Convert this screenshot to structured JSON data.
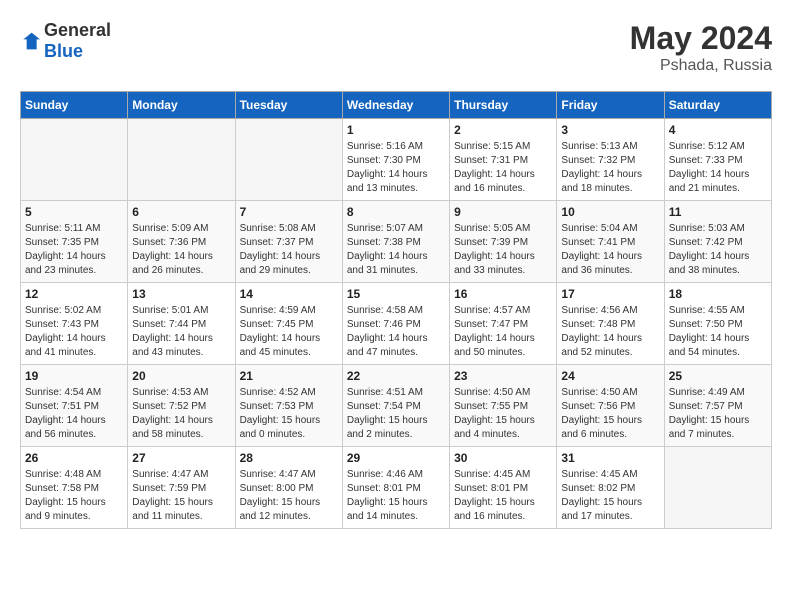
{
  "logo": {
    "general": "General",
    "blue": "Blue"
  },
  "title": {
    "month_year": "May 2024",
    "location": "Pshada, Russia"
  },
  "days_of_week": [
    "Sunday",
    "Monday",
    "Tuesday",
    "Wednesday",
    "Thursday",
    "Friday",
    "Saturday"
  ],
  "weeks": [
    [
      {
        "day": "",
        "info": ""
      },
      {
        "day": "",
        "info": ""
      },
      {
        "day": "",
        "info": ""
      },
      {
        "day": "1",
        "info": "Sunrise: 5:16 AM\nSunset: 7:30 PM\nDaylight: 14 hours\nand 13 minutes."
      },
      {
        "day": "2",
        "info": "Sunrise: 5:15 AM\nSunset: 7:31 PM\nDaylight: 14 hours\nand 16 minutes."
      },
      {
        "day": "3",
        "info": "Sunrise: 5:13 AM\nSunset: 7:32 PM\nDaylight: 14 hours\nand 18 minutes."
      },
      {
        "day": "4",
        "info": "Sunrise: 5:12 AM\nSunset: 7:33 PM\nDaylight: 14 hours\nand 21 minutes."
      }
    ],
    [
      {
        "day": "5",
        "info": "Sunrise: 5:11 AM\nSunset: 7:35 PM\nDaylight: 14 hours\nand 23 minutes."
      },
      {
        "day": "6",
        "info": "Sunrise: 5:09 AM\nSunset: 7:36 PM\nDaylight: 14 hours\nand 26 minutes."
      },
      {
        "day": "7",
        "info": "Sunrise: 5:08 AM\nSunset: 7:37 PM\nDaylight: 14 hours\nand 29 minutes."
      },
      {
        "day": "8",
        "info": "Sunrise: 5:07 AM\nSunset: 7:38 PM\nDaylight: 14 hours\nand 31 minutes."
      },
      {
        "day": "9",
        "info": "Sunrise: 5:05 AM\nSunset: 7:39 PM\nDaylight: 14 hours\nand 33 minutes."
      },
      {
        "day": "10",
        "info": "Sunrise: 5:04 AM\nSunset: 7:41 PM\nDaylight: 14 hours\nand 36 minutes."
      },
      {
        "day": "11",
        "info": "Sunrise: 5:03 AM\nSunset: 7:42 PM\nDaylight: 14 hours\nand 38 minutes."
      }
    ],
    [
      {
        "day": "12",
        "info": "Sunrise: 5:02 AM\nSunset: 7:43 PM\nDaylight: 14 hours\nand 41 minutes."
      },
      {
        "day": "13",
        "info": "Sunrise: 5:01 AM\nSunset: 7:44 PM\nDaylight: 14 hours\nand 43 minutes."
      },
      {
        "day": "14",
        "info": "Sunrise: 4:59 AM\nSunset: 7:45 PM\nDaylight: 14 hours\nand 45 minutes."
      },
      {
        "day": "15",
        "info": "Sunrise: 4:58 AM\nSunset: 7:46 PM\nDaylight: 14 hours\nand 47 minutes."
      },
      {
        "day": "16",
        "info": "Sunrise: 4:57 AM\nSunset: 7:47 PM\nDaylight: 14 hours\nand 50 minutes."
      },
      {
        "day": "17",
        "info": "Sunrise: 4:56 AM\nSunset: 7:48 PM\nDaylight: 14 hours\nand 52 minutes."
      },
      {
        "day": "18",
        "info": "Sunrise: 4:55 AM\nSunset: 7:50 PM\nDaylight: 14 hours\nand 54 minutes."
      }
    ],
    [
      {
        "day": "19",
        "info": "Sunrise: 4:54 AM\nSunset: 7:51 PM\nDaylight: 14 hours\nand 56 minutes."
      },
      {
        "day": "20",
        "info": "Sunrise: 4:53 AM\nSunset: 7:52 PM\nDaylight: 14 hours\nand 58 minutes."
      },
      {
        "day": "21",
        "info": "Sunrise: 4:52 AM\nSunset: 7:53 PM\nDaylight: 15 hours\nand 0 minutes."
      },
      {
        "day": "22",
        "info": "Sunrise: 4:51 AM\nSunset: 7:54 PM\nDaylight: 15 hours\nand 2 minutes."
      },
      {
        "day": "23",
        "info": "Sunrise: 4:50 AM\nSunset: 7:55 PM\nDaylight: 15 hours\nand 4 minutes."
      },
      {
        "day": "24",
        "info": "Sunrise: 4:50 AM\nSunset: 7:56 PM\nDaylight: 15 hours\nand 6 minutes."
      },
      {
        "day": "25",
        "info": "Sunrise: 4:49 AM\nSunset: 7:57 PM\nDaylight: 15 hours\nand 7 minutes."
      }
    ],
    [
      {
        "day": "26",
        "info": "Sunrise: 4:48 AM\nSunset: 7:58 PM\nDaylight: 15 hours\nand 9 minutes."
      },
      {
        "day": "27",
        "info": "Sunrise: 4:47 AM\nSunset: 7:59 PM\nDaylight: 15 hours\nand 11 minutes."
      },
      {
        "day": "28",
        "info": "Sunrise: 4:47 AM\nSunset: 8:00 PM\nDaylight: 15 hours\nand 12 minutes."
      },
      {
        "day": "29",
        "info": "Sunrise: 4:46 AM\nSunset: 8:01 PM\nDaylight: 15 hours\nand 14 minutes."
      },
      {
        "day": "30",
        "info": "Sunrise: 4:45 AM\nSunset: 8:01 PM\nDaylight: 15 hours\nand 16 minutes."
      },
      {
        "day": "31",
        "info": "Sunrise: 4:45 AM\nSunset: 8:02 PM\nDaylight: 15 hours\nand 17 minutes."
      },
      {
        "day": "",
        "info": ""
      }
    ]
  ]
}
